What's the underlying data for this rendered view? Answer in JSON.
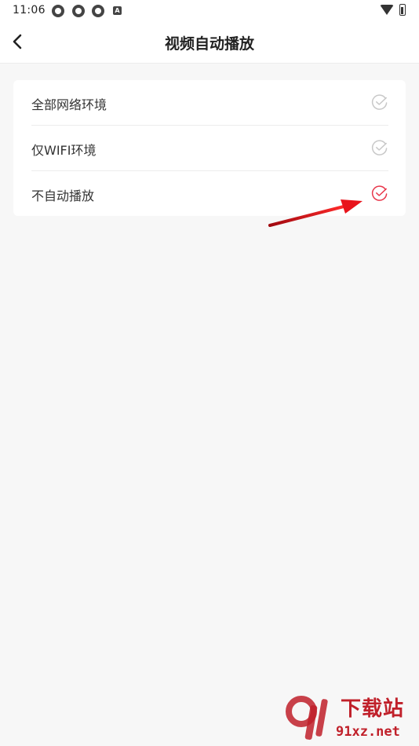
{
  "status_bar": {
    "time": "11:06",
    "notification_icons": [
      "app-icon",
      "app-icon",
      "app-icon",
      "a-icon"
    ],
    "a_badge": "A"
  },
  "header": {
    "title": "视频自动播放",
    "back_icon": "chevron-left-icon"
  },
  "options": [
    {
      "label": "全部网络环境",
      "selected": false
    },
    {
      "label": "仅WIFI环境",
      "selected": false
    },
    {
      "label": "不自动播放",
      "selected": true
    }
  ],
  "colors": {
    "accent": "#e8374b",
    "unselected": "#c8c8c8",
    "annotation": "#e0141c",
    "background": "#f7f7f7"
  },
  "watermark": {
    "text": "下载站",
    "url": "91xz.net"
  }
}
